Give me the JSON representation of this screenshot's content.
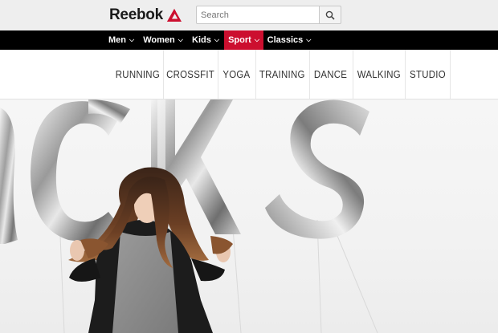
{
  "header": {
    "brand": "Reebok",
    "search": {
      "placeholder": "Search",
      "value": ""
    }
  },
  "main_nav": [
    {
      "label": "Men",
      "active": false
    },
    {
      "label": "Women",
      "active": false
    },
    {
      "label": "Kids",
      "active": false
    },
    {
      "label": "Sport",
      "active": true
    },
    {
      "label": "Classics",
      "active": false
    }
  ],
  "sport_menu": [
    "RUNNING",
    "CROSSFIT",
    "YOGA",
    "TRAINING",
    "DANCE",
    "WALKING",
    "STUDIO"
  ],
  "colors": {
    "accent": "#cc0f2f",
    "nav_bg": "#000000",
    "header_bg": "#eeeeee"
  },
  "icons": [
    "reebok-delta-logo",
    "search-icon",
    "chevron-down-icon"
  ]
}
